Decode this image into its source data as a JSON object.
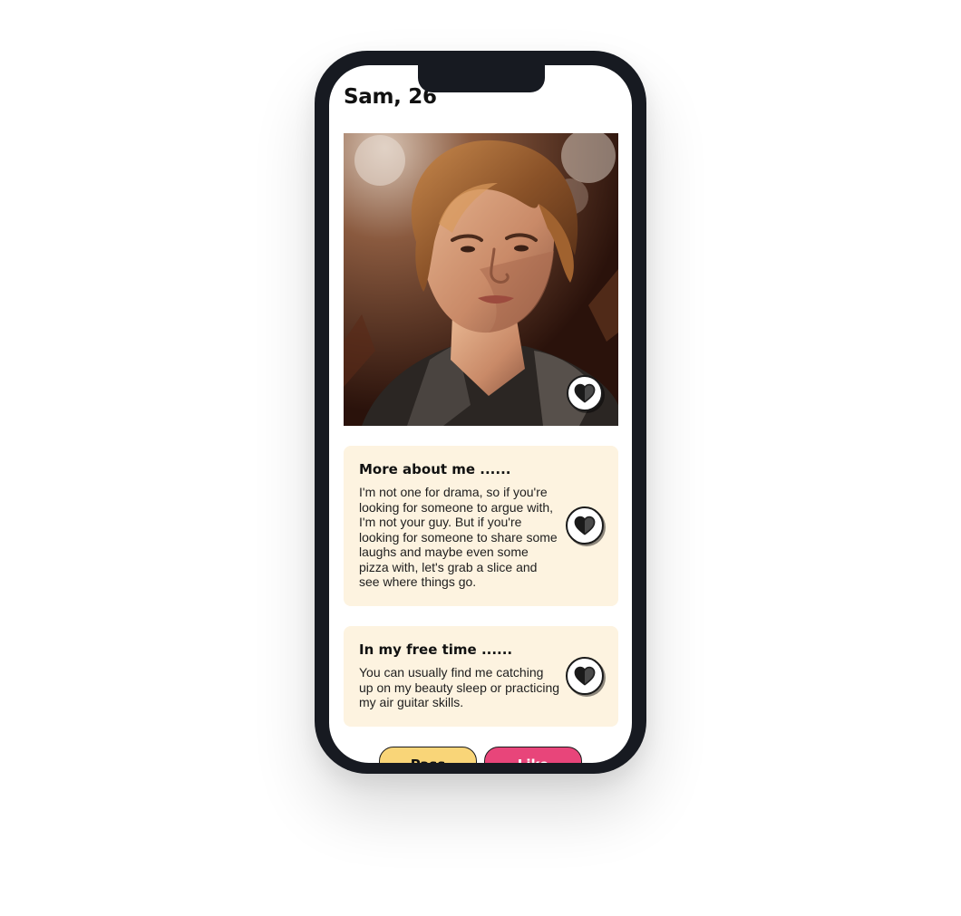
{
  "profile": {
    "name_age": "Sam, 26",
    "photo_alt": "Profile photo of Sam"
  },
  "about": {
    "heading": "More about me ......",
    "text": "I'm not one for drama, so if you're looking for someone to argue with, I'm not your guy. But if you're looking for someone to share some laughs and maybe even some pizza with, let's grab a slice and see where things go."
  },
  "free_time": {
    "heading": "In my free time ......",
    "text": "You can usually find me catching up on my beauty sleep or practicing my air guitar skills."
  },
  "actions": {
    "pass_label": "Pass",
    "like_label": "Like"
  },
  "colors": {
    "phone_frame": "#171a21",
    "card_bg": "#fdf3e0",
    "pass_button": "#f9d578",
    "like_button": "#e8457a"
  },
  "icons": {
    "like": "heart-half-icon"
  }
}
